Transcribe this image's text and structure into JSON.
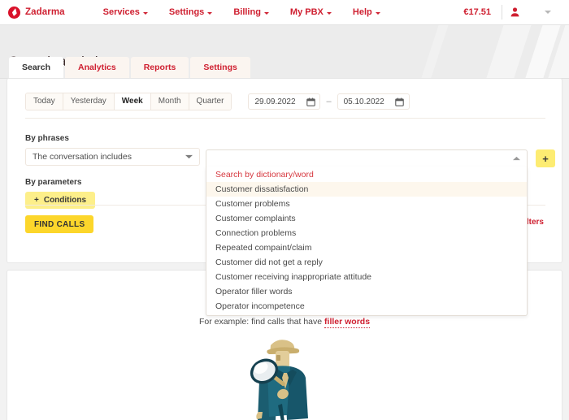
{
  "topnav": {
    "brand": "Zadarma",
    "brand_logo_icon": "zadarma-drop-logo",
    "items": [
      {
        "label": "Services",
        "icon": "chevron-down-icon"
      },
      {
        "label": "Settings",
        "icon": "chevron-down-icon"
      },
      {
        "label": "Billing",
        "icon": "chevron-down-icon"
      },
      {
        "label": "My PBX",
        "icon": "chevron-down-icon"
      },
      {
        "label": "Help",
        "icon": "chevron-down-icon"
      }
    ],
    "balance": "€17.51",
    "user_icon": "user-icon",
    "right_caret_icon": "chevron-down-icon"
  },
  "header": {
    "title": "Speech analytics"
  },
  "tabs": [
    {
      "label": "Search",
      "active": true
    },
    {
      "label": "Analytics",
      "active": false
    },
    {
      "label": "Reports",
      "active": false
    },
    {
      "label": "Settings",
      "active": false
    }
  ],
  "filters": {
    "period_buttons": [
      {
        "label": "Today",
        "selected": false
      },
      {
        "label": "Yesterday",
        "selected": false
      },
      {
        "label": "Week",
        "selected": true
      },
      {
        "label": "Month",
        "selected": false
      },
      {
        "label": "Quarter",
        "selected": false
      }
    ],
    "date_from": "29.09.2022",
    "date_to": "05.10.2022",
    "date_separator": "–",
    "calendar_icon": "calendar-icon"
  },
  "phrases": {
    "section_label": "By phrases",
    "condition_value": "The conversation includes",
    "condition_caret_icon": "chevron-down-icon",
    "word_value": "",
    "word_placeholder": "",
    "word_caret_icon": "chevron-up-icon",
    "add_button_label": "+",
    "add_button_icon": "plus-icon"
  },
  "parameters": {
    "section_label": "By parameters",
    "conditions_button": "Conditions",
    "conditions_icon": "plus-icon"
  },
  "actions": {
    "find_calls": "FIND CALLS",
    "clear_filters": "Clear filters"
  },
  "dropdown": {
    "items": [
      {
        "label": "Search by dictionary/word",
        "kind": "head"
      },
      {
        "label": "Customer dissatisfaction",
        "kind": "highlighted"
      },
      {
        "label": "Customer problems",
        "kind": "normal"
      },
      {
        "label": "Customer complaints",
        "kind": "normal"
      },
      {
        "label": "Connection problems",
        "kind": "normal"
      },
      {
        "label": "Repeated compaint/claim",
        "kind": "normal"
      },
      {
        "label": "Customer did not get a reply",
        "kind": "normal"
      },
      {
        "label": "Customer receiving inappropriate attitude",
        "kind": "normal"
      },
      {
        "label": "Operator filler words",
        "kind": "normal"
      },
      {
        "label": "Operator incompetence",
        "kind": "normal"
      }
    ]
  },
  "results": {
    "example_prefix": "For example: find calls that have ",
    "example_link": "filler words",
    "illustration_icon": "detective-magnifier-illustration"
  },
  "colors": {
    "brand_red": "#cf2031",
    "accent_yellow": "#fcd62b",
    "light_yellow": "#fdef8a",
    "page_bg": "#f2f2f2",
    "illustration_teal": "#17566a"
  }
}
